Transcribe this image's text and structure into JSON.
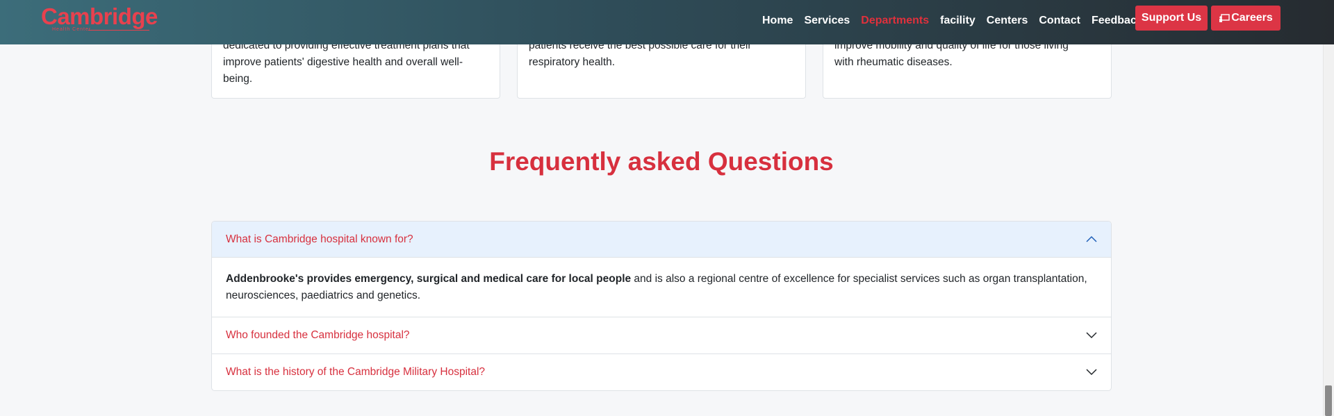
{
  "brand": {
    "logo_text": "Cambridge",
    "logo_subtitle": "Health Center",
    "accent_color": "#dc3545"
  },
  "nav": {
    "links": [
      {
        "label": "Home"
      },
      {
        "label": "Services"
      },
      {
        "label": "Departments",
        "active": true
      },
      {
        "label": "facility"
      },
      {
        "label": "Centers"
      },
      {
        "label": "Contact"
      },
      {
        "label": "Feedback"
      }
    ],
    "support_button": "Support Us",
    "careers_button": "Careers",
    "careers_icon": "person-chalkboard-icon"
  },
  "cards": [
    {
      "lines": [
        "dedicated to providing effective treatment plans that",
        "improve patients' digestive health and overall well-",
        "being."
      ]
    },
    {
      "lines": [
        "patients receive the best possible care for their",
        "respiratory health."
      ]
    },
    {
      "lines": [
        "improve mobility and quality of life for those living",
        "with rheumatic diseases."
      ]
    }
  ],
  "faq": {
    "title": "Frequently asked Questions",
    "items": [
      {
        "question": "What is Cambridge hospital known for?",
        "open": true,
        "answer_bold": "Addenbrooke's provides emergency, surgical and medical care for local people",
        "answer_rest": " and is also a regional centre of excellence for specialist services such as organ transplantation, neurosciences, paediatrics and genetics."
      },
      {
        "question": "Who founded the Cambridge hospital?",
        "open": false
      },
      {
        "question": "What is the history of the Cambridge Military Hospital?",
        "open": false
      }
    ]
  }
}
